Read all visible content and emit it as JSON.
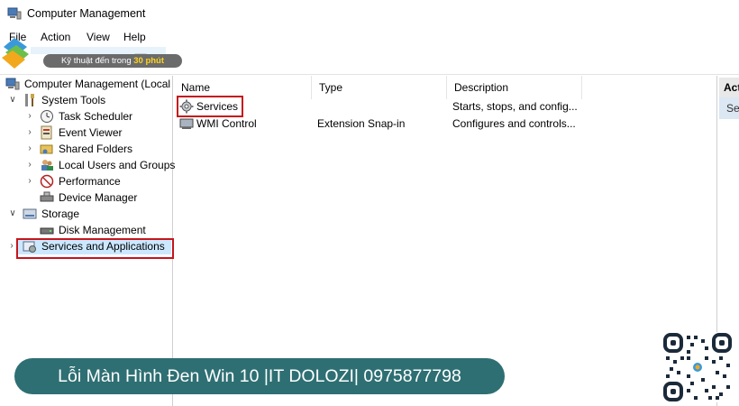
{
  "window": {
    "title": "Computer Management"
  },
  "menu": [
    "File",
    "Action",
    "View",
    "Help"
  ],
  "watermark": {
    "tagline_prefix": "Kỹ thuật đến trong",
    "tagline_highlight": "30 phút"
  },
  "tree": {
    "root": "Computer Management (Local",
    "system_tools": "System Tools",
    "task_scheduler": "Task Scheduler",
    "event_viewer": "Event Viewer",
    "shared_folders": "Shared Folders",
    "local_users": "Local Users and Groups",
    "performance": "Performance",
    "device_manager": "Device Manager",
    "storage": "Storage",
    "disk_management": "Disk Management",
    "services_apps": "Services and Applications"
  },
  "list": {
    "columns": [
      "Name",
      "Type",
      "Description"
    ],
    "rows": [
      {
        "name": "Services",
        "type": "",
        "description": "Starts, stops, and config..."
      },
      {
        "name": "WMI Control",
        "type": "Extension Snap-in",
        "description": "Configures and controls..."
      }
    ]
  },
  "actions": {
    "header": "Act",
    "item": "Ser"
  },
  "caption": "Lỗi Màn Hình Đen Win 10 |IT DOLOZI| 0975877798",
  "colors": {
    "highlight_box": "#c4161c",
    "caption_bg": "#2e6f73",
    "selection": "#cce8ff"
  }
}
